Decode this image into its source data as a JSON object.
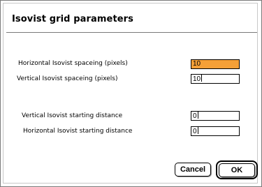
{
  "dialog": {
    "title": "Isovist grid parameters"
  },
  "fields": {
    "horizontal_spacing": {
      "label": "Horizontal Isovist spaceing (pixels)",
      "value": "10",
      "selected": true
    },
    "vertical_spacing": {
      "label": "Vertical Isovist spaceing (pixels)",
      "value": "10"
    },
    "vertical_start": {
      "label": "Vertical Isovist starting distance",
      "value": "0"
    },
    "horizontal_start": {
      "label": "Horizontal Isovist starting distance",
      "value": "0"
    }
  },
  "buttons": {
    "cancel_label": "Cancel",
    "ok_label": "OK"
  },
  "colors": {
    "selection_highlight": "#f5a037",
    "border": "#000000",
    "background": "#ffffff"
  }
}
